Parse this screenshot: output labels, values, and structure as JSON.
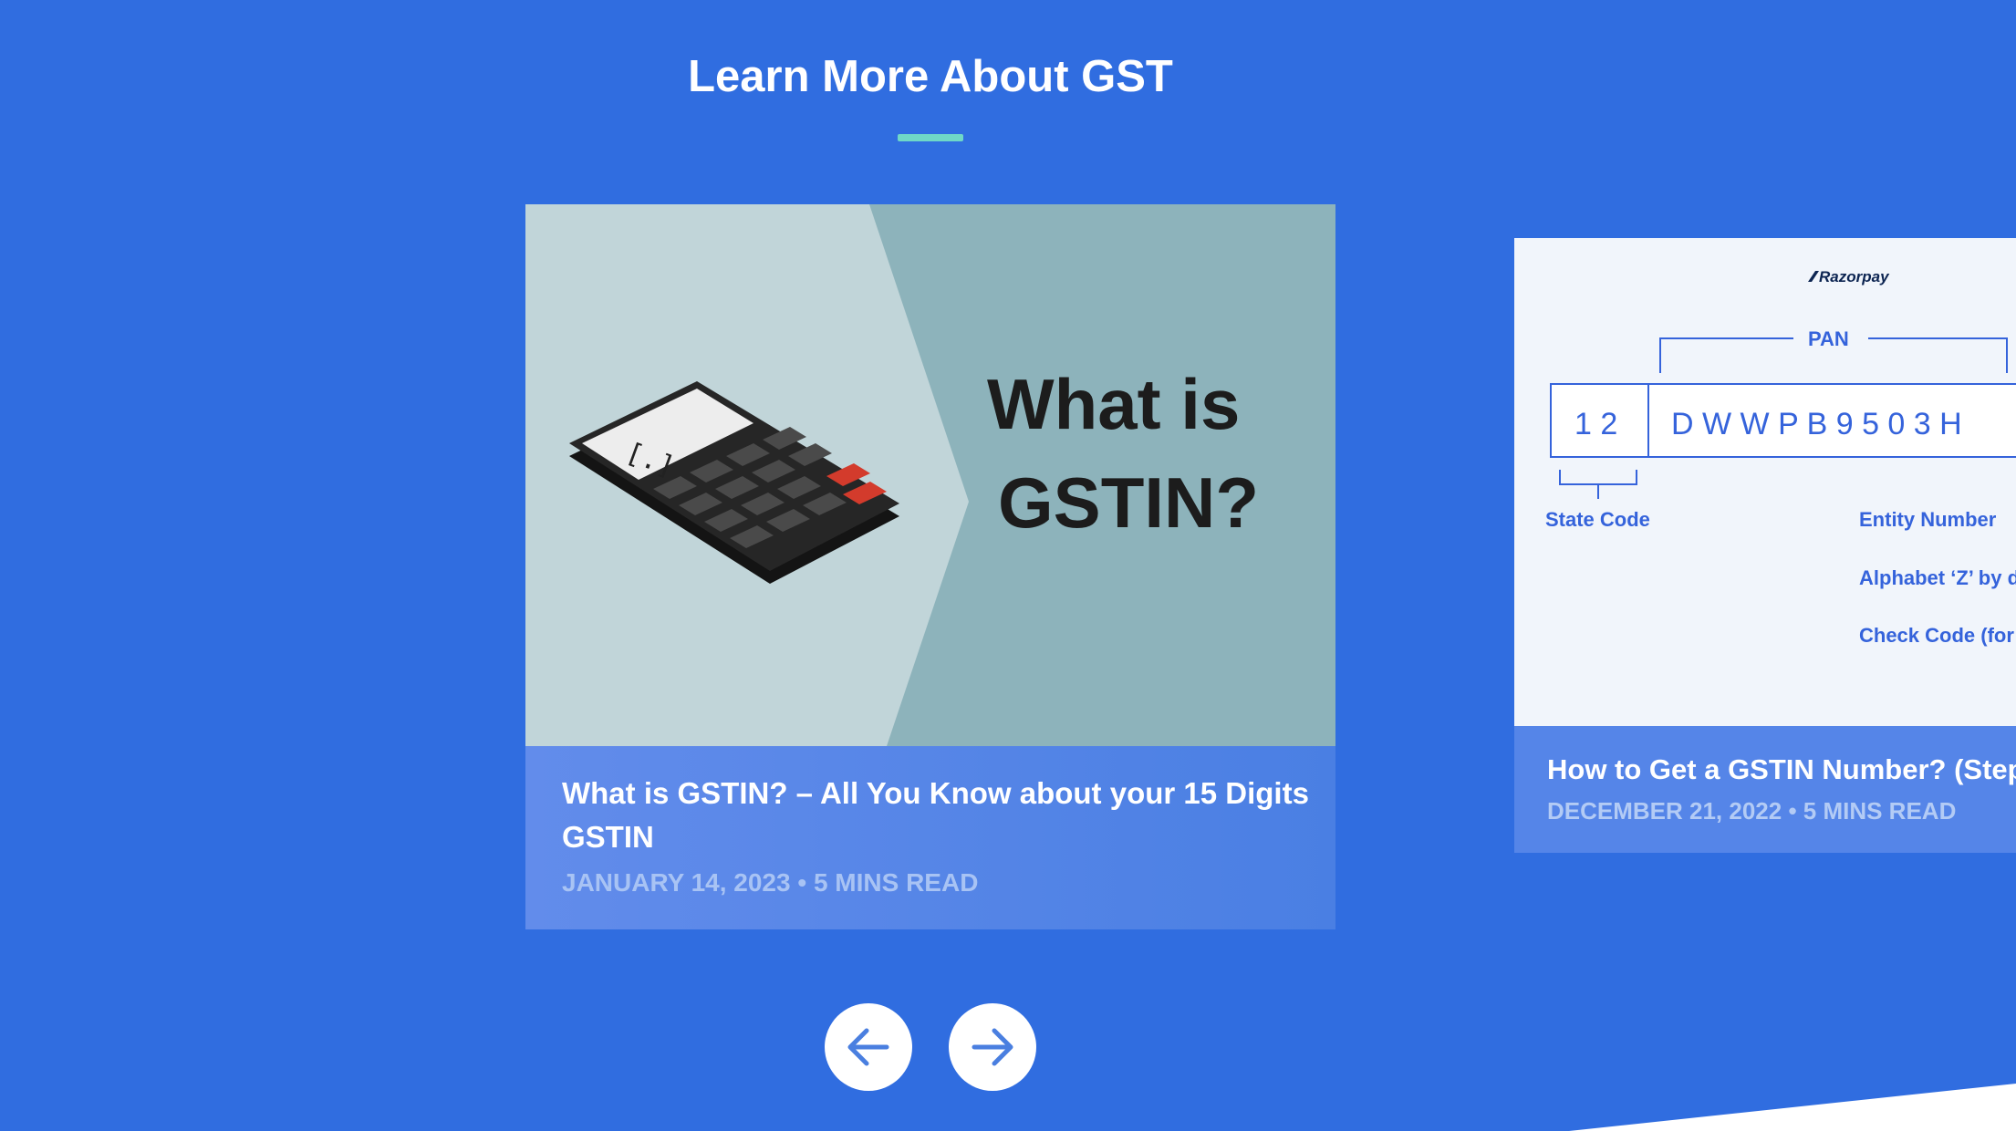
{
  "section": {
    "title": "Learn More About GST"
  },
  "cards": [
    {
      "thumbnail_text_line1": "What is",
      "thumbnail_text_line2": "GSTIN?",
      "title": "What is GSTIN? – All You Know about your 15 Digits GSTIN",
      "meta": "JANUARY 14, 2023 • 5 MINS READ"
    },
    {
      "brand": "Razorpay",
      "pan_label": "PAN",
      "state_code_digits": "1 2",
      "pan_chars": "D W W P B 9 5 0 3 H",
      "state_code_label": "State Code",
      "entity_number_label": "Entity Number",
      "alphabet_label": "Alphabet ‘Z’ by d",
      "check_code_label": "Check Code (for",
      "title": "How to Get a GSTIN Number? (Step-B",
      "meta": "DECEMBER 21, 2022 • 5 MINS READ"
    }
  ],
  "nav": {
    "prev_icon": "arrow-left-icon",
    "next_icon": "arrow-right-icon"
  },
  "colors": {
    "background": "#306de0",
    "accent_underline": "#6fd8c7",
    "thumb_left": "#c1d5d9",
    "thumb_right": "#8db3bb",
    "razorpay_blue": "#3563db"
  }
}
